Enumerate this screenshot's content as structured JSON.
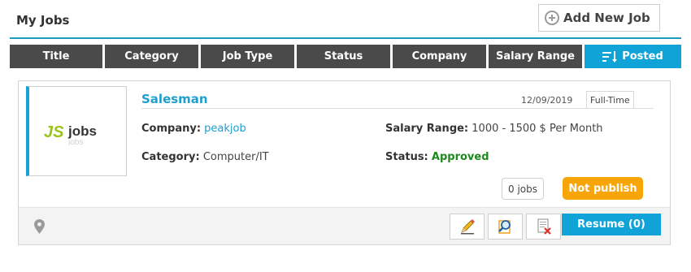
{
  "page": {
    "title": "My Jobs"
  },
  "toolbar": {
    "add_label": "Add New Job"
  },
  "sort_tabs": [
    {
      "label": "Title"
    },
    {
      "label": "Category"
    },
    {
      "label": "Job Type"
    },
    {
      "label": "Status"
    },
    {
      "label": "Company"
    },
    {
      "label": "Salary Range"
    },
    {
      "label": "Posted",
      "active": true
    }
  ],
  "job": {
    "logo_text": "JS jobs",
    "title": "Salesman",
    "date": "12/09/2019",
    "job_type": "Full-Time",
    "company_label": "Company:",
    "company": "peakjob",
    "category_label": "Category:",
    "category": "Computer/IT",
    "salary_label": "Salary Range:",
    "salary": "1000 - 1500 $ Per Month",
    "status_label": "Status:",
    "status": "Approved",
    "jobs_count": "0 jobs",
    "publish_state": "Not publish",
    "resume_label": "Resume (0)"
  },
  "colors": {
    "accent": "#0fa3d8",
    "tab_bg": "#4a4a4a",
    "warning": "#f7a509",
    "approved": "#1e8a1e"
  },
  "icons": [
    "plus-circle-icon",
    "sort-icon",
    "map-pin-icon",
    "edit-pencil-icon",
    "search-copy-icon",
    "delete-doc-icon"
  ]
}
